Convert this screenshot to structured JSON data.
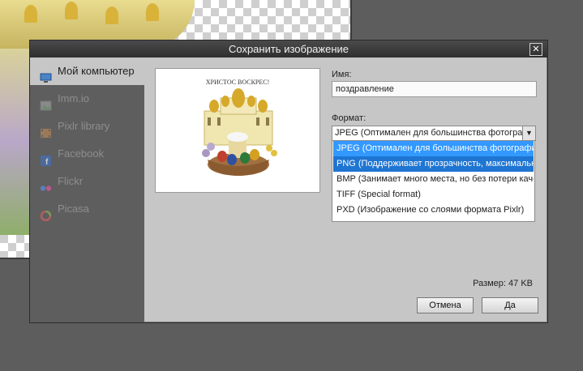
{
  "dialog": {
    "title": "Сохранить изображение"
  },
  "sidebar": {
    "items": [
      {
        "label": "Мой компьютер",
        "icon": "computer-icon",
        "active": true
      },
      {
        "label": "Imm.io",
        "icon": "image-icon",
        "active": false
      },
      {
        "label": "Pixlr library",
        "icon": "film-icon",
        "active": false
      },
      {
        "label": "Facebook",
        "icon": "facebook-icon",
        "active": false
      },
      {
        "label": "Flickr",
        "icon": "flickr-icon",
        "active": false
      },
      {
        "label": "Picasa",
        "icon": "picasa-icon",
        "active": false
      }
    ]
  },
  "preview": {
    "caption": "ХРИСТОС ВОСКРЕС!"
  },
  "form": {
    "name_label": "Имя:",
    "name_value": "поздравление",
    "format_label": "Формат:",
    "format_selected": "JPEG (Оптимален для большинства фотографий)",
    "format_options": [
      "JPEG (Оптимален для большинства фотографий)",
      "PNG (Поддерживает прозрачность, максимальное качество)",
      "BMP (Занимает много места, но без потери качества)",
      "TIFF (Special format)",
      "PXD (Изображение со слоями формата Pixlr)"
    ],
    "size_text": "Размер: 47 KB"
  },
  "buttons": {
    "cancel": "Отмена",
    "ok": "Да"
  },
  "colors": {
    "highlight": "#3399ff",
    "highlight_dark": "#1e75d2",
    "titlebar": "#3a3a3a",
    "sidebar": "#5e5e5e"
  }
}
